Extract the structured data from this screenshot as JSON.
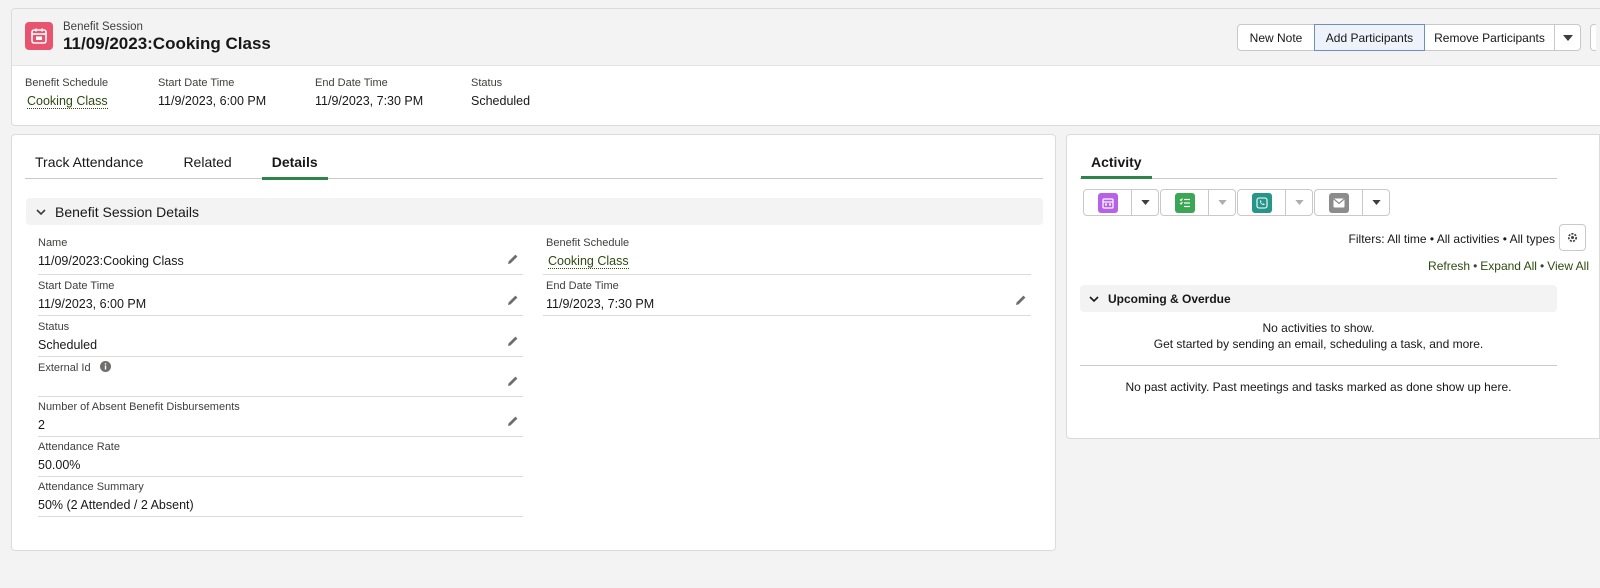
{
  "header": {
    "object_type": "Benefit Session",
    "title": "11/09/2023:Cooking Class",
    "buttons": {
      "new_note": "New Note",
      "add_participants": "Add Participants",
      "remove_participants": "Remove Participants"
    },
    "highlights": [
      {
        "label": "Benefit Schedule",
        "value": "Cooking Class"
      },
      {
        "label": "Start Date Time",
        "value": "11/9/2023, 6:00 PM"
      },
      {
        "label": "End Date Time",
        "value": "11/9/2023, 7:30 PM"
      },
      {
        "label": "Status",
        "value": "Scheduled"
      }
    ]
  },
  "tabs": {
    "track": "Track Attendance",
    "related": "Related",
    "details": "Details"
  },
  "section": {
    "title": "Benefit Session Details",
    "fields": {
      "name": {
        "label": "Name",
        "value": "11/09/2023:Cooking Class"
      },
      "benefit_schedule": {
        "label": "Benefit Schedule",
        "value": "Cooking Class"
      },
      "start": {
        "label": "Start Date Time",
        "value": "11/9/2023, 6:00 PM"
      },
      "end": {
        "label": "End Date Time",
        "value": "11/9/2023, 7:30 PM"
      },
      "status": {
        "label": "Status",
        "value": "Scheduled"
      },
      "external_id": {
        "label": "External Id",
        "value": ""
      },
      "absent": {
        "label": "Number of Absent Benefit Disbursements",
        "value": "2"
      },
      "rate": {
        "label": "Attendance Rate",
        "value": "50.00%"
      },
      "summary": {
        "label": "Attendance Summary",
        "value": "50% (2 Attended / 2 Absent)"
      }
    }
  },
  "activity": {
    "tab": "Activity",
    "filters": "Filters: All time • All activities • All types",
    "links": {
      "refresh": "Refresh",
      "expand": "Expand All",
      "view": "View All"
    },
    "upcoming": "Upcoming & Overdue",
    "no_activities": "No activities to show.",
    "get_started": "Get started by sending an email, scheduling a task, and more.",
    "no_past": "No past activity. Past meetings and tasks marked as done show up here."
  },
  "colors": {
    "object_icon": "#e8546f",
    "event": "#b661e8",
    "task": "#3ba755",
    "call": "#26968b",
    "email": "#8c8c8c",
    "active_tab": "#2e844a"
  }
}
